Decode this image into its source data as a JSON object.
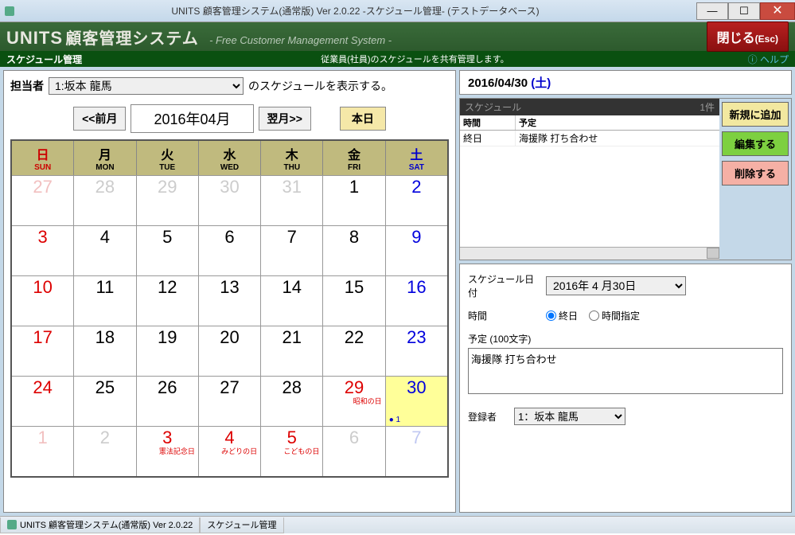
{
  "titlebar": {
    "title": "UNITS 顧客管理システム(通常版)  Ver 2.0.22 -スケジュール管理- (テストデータベース)"
  },
  "header": {
    "logo_units": "UNITS",
    "logo_jp": "顧客管理システム",
    "tagline": "- Free Customer Management System -",
    "close_label": "閉じる",
    "close_key": "(Esc)"
  },
  "subheader": {
    "left": "スケジュール管理",
    "mid": "従業員(社員)のスケジュールを共有管理します。",
    "help": "ヘルプ"
  },
  "assignee": {
    "label": "担当者",
    "value": "1:坂本 龍馬",
    "suffix": "のスケジュールを表示する。"
  },
  "nav": {
    "prev": "<<前月",
    "month": "2016年04月",
    "next": "翌月>>",
    "today": "本日"
  },
  "dow": [
    {
      "jp": "日",
      "en": "SUN",
      "cls": "sun"
    },
    {
      "jp": "月",
      "en": "MON",
      "cls": ""
    },
    {
      "jp": "火",
      "en": "TUE",
      "cls": ""
    },
    {
      "jp": "水",
      "en": "WED",
      "cls": ""
    },
    {
      "jp": "木",
      "en": "THU",
      "cls": ""
    },
    {
      "jp": "金",
      "en": "FRI",
      "cls": ""
    },
    {
      "jp": "土",
      "en": "SAT",
      "cls": "sat"
    }
  ],
  "weeks": [
    [
      {
        "n": "27",
        "o": true
      },
      {
        "n": "28",
        "o": true
      },
      {
        "n": "29",
        "o": true
      },
      {
        "n": "30",
        "o": true
      },
      {
        "n": "31",
        "o": true
      },
      {
        "n": "1"
      },
      {
        "n": "2"
      }
    ],
    [
      {
        "n": "3"
      },
      {
        "n": "4"
      },
      {
        "n": "5"
      },
      {
        "n": "6"
      },
      {
        "n": "7"
      },
      {
        "n": "8"
      },
      {
        "n": "9"
      }
    ],
    [
      {
        "n": "10"
      },
      {
        "n": "11"
      },
      {
        "n": "12"
      },
      {
        "n": "13"
      },
      {
        "n": "14"
      },
      {
        "n": "15"
      },
      {
        "n": "16"
      }
    ],
    [
      {
        "n": "17"
      },
      {
        "n": "18"
      },
      {
        "n": "19"
      },
      {
        "n": "20"
      },
      {
        "n": "21"
      },
      {
        "n": "22"
      },
      {
        "n": "23"
      }
    ],
    [
      {
        "n": "24"
      },
      {
        "n": "25"
      },
      {
        "n": "26"
      },
      {
        "n": "27"
      },
      {
        "n": "28"
      },
      {
        "n": "29",
        "h": "昭和の日"
      },
      {
        "n": "30",
        "sel": true,
        "ev": "● 1"
      }
    ],
    [
      {
        "n": "1",
        "o": true
      },
      {
        "n": "2",
        "o": true
      },
      {
        "n": "3",
        "o": true,
        "h": "憲法記念日"
      },
      {
        "n": "4",
        "o": true,
        "h": "みどりの日"
      },
      {
        "n": "5",
        "o": true,
        "h": "こどもの日"
      },
      {
        "n": "6",
        "o": true
      },
      {
        "n": "7",
        "o": true
      }
    ]
  ],
  "selected_date": {
    "text": "2016/04/30",
    "dow": " (土)"
  },
  "schedule": {
    "title": "スケジュール",
    "count": "1件",
    "col_time": "時間",
    "col_plan": "予定",
    "rows": [
      {
        "time": "終日",
        "plan": "海援隊 打ち合わせ"
      }
    ],
    "btn_new": "新規に追加",
    "btn_edit": "編集する",
    "btn_del": "削除する"
  },
  "detail": {
    "date_label": "スケジュール日付",
    "date_value": "2016年 4 月30日",
    "time_label": "時間",
    "radio_allday": "終日",
    "radio_timed": "時間指定",
    "plan_label": "予定 (100文字)",
    "plan_value": "海援隊 打ち合わせ",
    "reg_label": "登録者",
    "reg_value": "1：坂本 龍馬"
  },
  "status": {
    "seg1": "UNITS 顧客管理システム(通常版)  Ver 2.0.22",
    "seg2": "スケジュール管理"
  }
}
